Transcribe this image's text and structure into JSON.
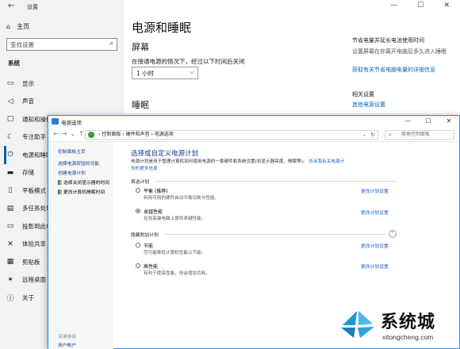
{
  "settings": {
    "app_title": "设置",
    "home": "主页",
    "search_placeholder": "查找设置",
    "section": "系统",
    "nav": [
      "显示",
      "声音",
      "通知和操作",
      "专注助手",
      "电源和睡眠",
      "存储",
      "平板模式",
      "多任务处理",
      "投影到此电",
      "体验共享",
      "剪贴板",
      "远程桌面",
      "关于"
    ],
    "nav_icons": [
      "monitor-icon",
      "speaker-icon",
      "notification-icon",
      "moon-icon",
      "power-icon",
      "storage-icon",
      "tablet-icon",
      "multitask-icon",
      "project-icon",
      "share-icon",
      "clipboard-icon",
      "remote-icon",
      "info-icon"
    ],
    "active_nav": "电源和睡眠",
    "page_title": "电源和睡眠",
    "screen_heading": "屏幕",
    "screen_label": "在接通电源的情况下，经过以下时间后关闭",
    "screen_value": "1 小时",
    "sleep_heading": "睡眠",
    "right_heading": "节省电量并延长电池使用时间",
    "right_text": "设置屏幕在你离开电脑后多久进入睡眠",
    "right_link": "获取有关节省电脑电量的详细信息",
    "related_heading": "相关设置",
    "related_link": "其他电源设置"
  },
  "control_panel": {
    "window_title": "电源选项",
    "breadcrumb": [
      "控制面板",
      "硬件和声音",
      "电源选项"
    ],
    "search_placeholder": "搜索控制面板",
    "left_links": [
      "控制面板主页",
      "选择电源按钮的功能",
      "创建电源计划",
      "选择关闭显示器的时间",
      "更改计算机睡眠时间"
    ],
    "see_also": "另请参阅",
    "user_accounts": "用户帐户",
    "heading": "选择或自定义电源计划",
    "description": "电源计划是用于管理计算机如何使用电源的一套硬件和系统设置(如显示器亮度、睡眠等)。",
    "description_link": "告诉我有关电源计划的更多信息",
    "preferred_label": "首选计划",
    "plans": [
      {
        "name": "平衡 (推荐)",
        "desc": "利用可用的硬件自动平衡功耗与性能。",
        "selected": false
      },
      {
        "name": "卓越性能",
        "desc": "在较高端电脑上提供卓越性能。",
        "selected": true
      }
    ],
    "hidden_label": "隐藏附加计划",
    "hidden_plans": [
      {
        "name": "节能",
        "desc": "尽可能降低计算机性能以节能。",
        "selected": false
      },
      {
        "name": "高性能",
        "desc": "有利于提高性能，但会增加功耗。",
        "selected": false
      }
    ],
    "change_label": "更改计划设置"
  },
  "watermark": {
    "brand": "系统城",
    "url": "xitongcheng.com"
  }
}
